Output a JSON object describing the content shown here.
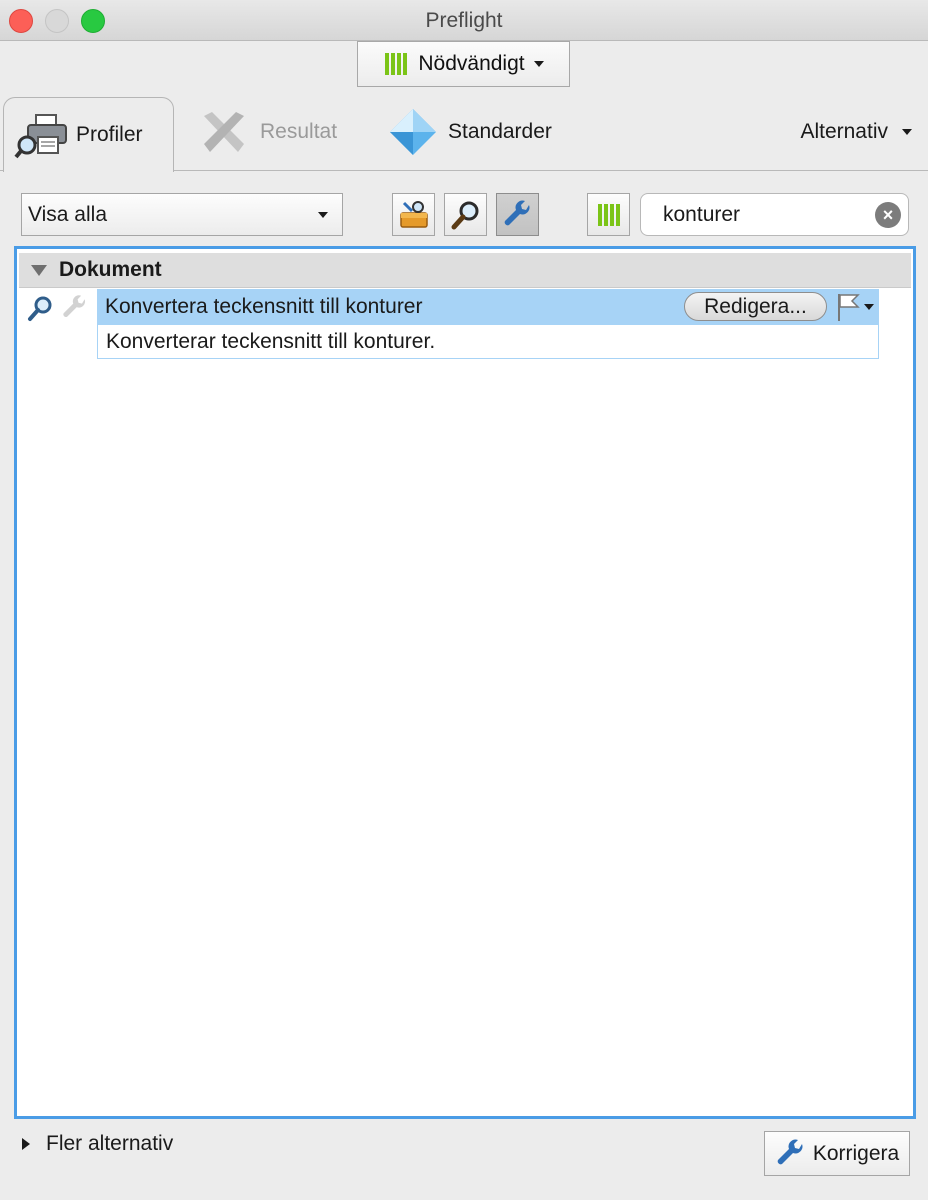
{
  "window": {
    "title": "Preflight"
  },
  "profile_selector": {
    "label": "Nödvändigt"
  },
  "tabs": [
    {
      "label": "Profiler",
      "active": true
    },
    {
      "label": "Resultat",
      "disabled": true
    },
    {
      "label": "Standarder"
    }
  ],
  "options_menu": {
    "label": "Alternativ"
  },
  "filter": {
    "selected": "Visa alla"
  },
  "search": {
    "value": "konturer"
  },
  "list": {
    "group": "Dokument",
    "item": {
      "title": "Konvertera teckensnitt till konturer",
      "edit_label": "Redigera...",
      "description": "Konverterar teckensnitt till konturer."
    }
  },
  "footer": {
    "more_label": "Fler alternativ",
    "fix_label": "Korrigera"
  },
  "colors": {
    "accent": "#4a9ce6",
    "selection": "#a7d3f6",
    "green": "#7bc417",
    "wrench": "#2f6fb8"
  }
}
